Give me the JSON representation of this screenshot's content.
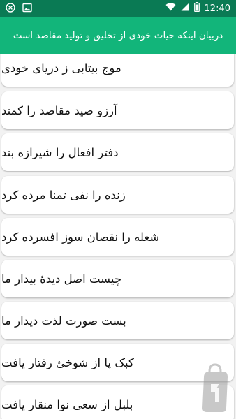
{
  "status_bar": {
    "time": "12:40",
    "left_icons": [
      "close-notification-icon",
      "image-icon"
    ],
    "right_icons": [
      "wifi-icon",
      "signal-icon",
      "battery-icon"
    ]
  },
  "app_bar": {
    "title": "دربیان اینکه حیات خودی از تخلیق و تولید مقاصد است"
  },
  "list": {
    "items": [
      "موج بیتابی ز دریای خودی",
      "آرزو صید مقاصد را کمند",
      "دفتر افعال را شیرازه بند",
      "زنده را نفی تمنا مرده کرد",
      "شعله را نقصان سوز افسرده کرد",
      "چیست اصل دیدهٔ بیدار ما",
      "بست صورت لذت دیدار ما",
      "کبک پا از شوخئ رفتار یافت",
      "بلبل از سعی نوا منقار یافت"
    ]
  },
  "colors": {
    "status_bar": "#0a7a54",
    "app_bar": "#12b57a",
    "background": "#f2f2f2",
    "card": "#ffffff",
    "text": "#111111"
  }
}
